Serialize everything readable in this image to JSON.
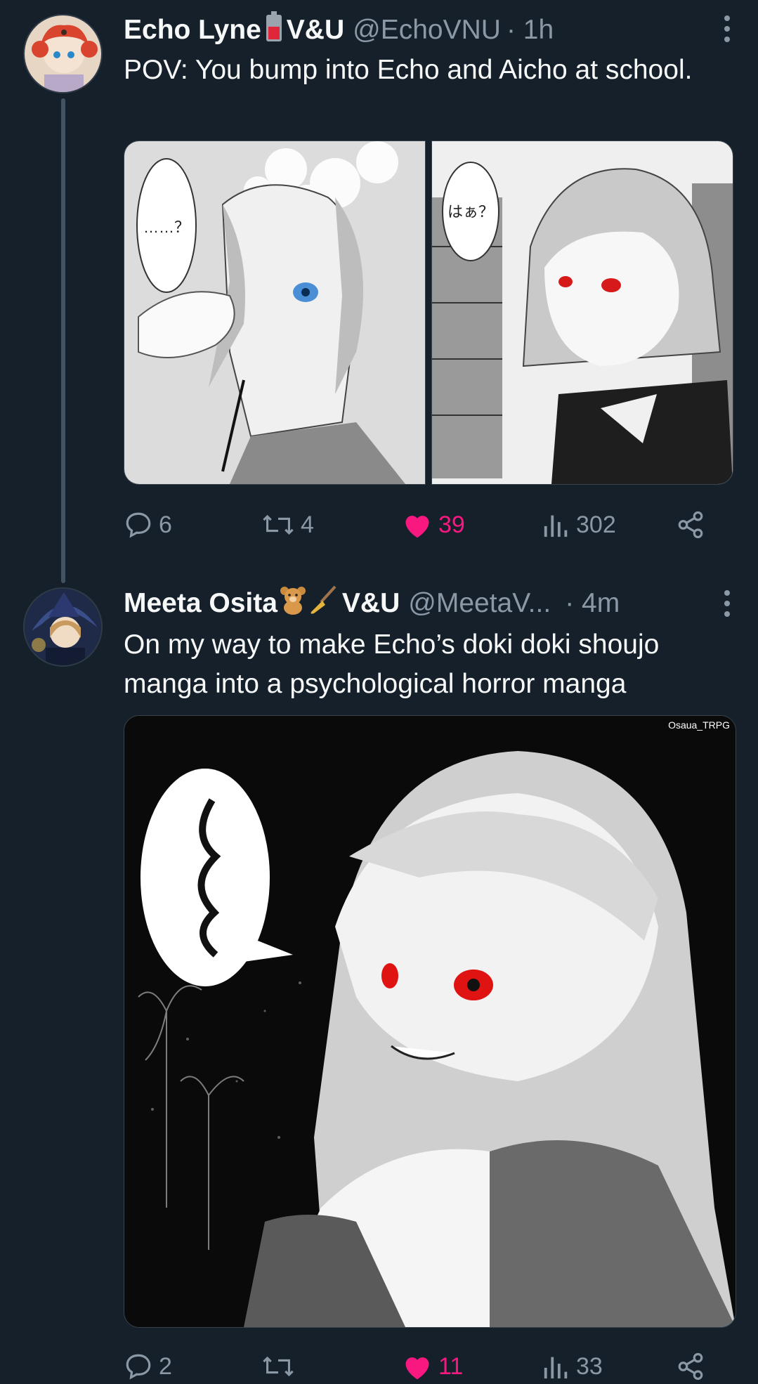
{
  "tweets": [
    {
      "author_name": "Echo Lyne",
      "author_emoji": "battery-icon",
      "author_suffix": "V&U",
      "handle": "@EchoVNU",
      "time": "· 1h",
      "text": "POV: You bump into Echo and Aicho at school.",
      "images": [
        {
          "speech": "……？",
          "scene": "cherry-blossom-girl"
        },
        {
          "speech": "はぁ？",
          "scene": "library-girl-red-eyes"
        }
      ],
      "replies": "6",
      "retweets": "4",
      "likes": "39",
      "views": "302"
    },
    {
      "author_name": "Meeta Osita",
      "author_emojis": [
        "teddy-bear-icon",
        "broom-icon"
      ],
      "author_suffix": "V&U",
      "handle": "@MeetaV...",
      "time": "· 4m",
      "text": "On my way to make Echo’s doki doki shoujo manga into a psychological horror manga",
      "image_watermark": "Osaua_TRPG",
      "replies": "2",
      "retweets": "",
      "likes": "11",
      "views": "33"
    }
  ],
  "colors": {
    "background": "#15202b",
    "text": "#f7f9f9",
    "muted": "#8b98a5",
    "like": "#f91880",
    "thread_line": "#425364"
  }
}
